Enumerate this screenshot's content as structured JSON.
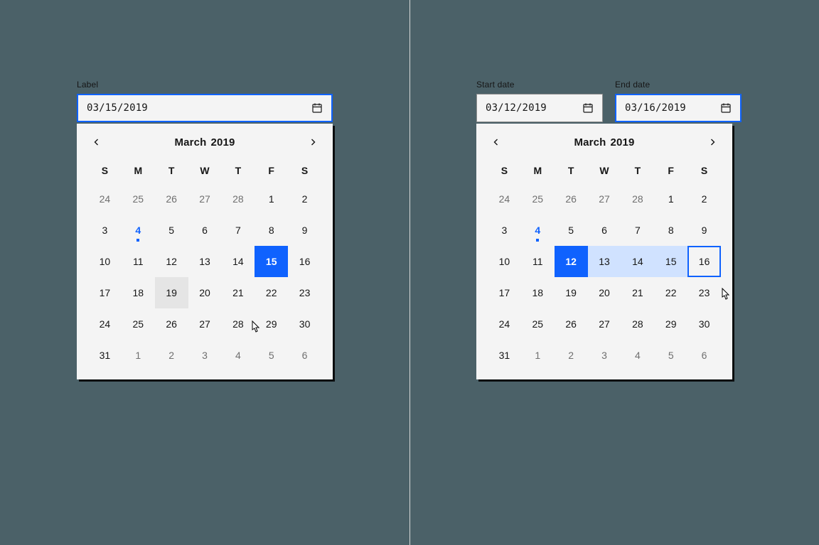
{
  "left": {
    "field_label": "Label",
    "input_value": "03/15/2019",
    "month": "March",
    "year": "2019",
    "dow": [
      "S",
      "M",
      "T",
      "W",
      "T",
      "F",
      "S"
    ],
    "weeks": [
      [
        {
          "n": "24",
          "out": true
        },
        {
          "n": "25",
          "out": true
        },
        {
          "n": "26",
          "out": true
        },
        {
          "n": "27",
          "out": true
        },
        {
          "n": "28",
          "out": true
        },
        {
          "n": "1"
        },
        {
          "n": "2"
        }
      ],
      [
        {
          "n": "3"
        },
        {
          "n": "4",
          "today": true
        },
        {
          "n": "5"
        },
        {
          "n": "6"
        },
        {
          "n": "7"
        },
        {
          "n": "8"
        },
        {
          "n": "9"
        }
      ],
      [
        {
          "n": "10"
        },
        {
          "n": "11"
        },
        {
          "n": "12"
        },
        {
          "n": "13"
        },
        {
          "n": "14"
        },
        {
          "n": "15",
          "selected": true
        },
        {
          "n": "16"
        }
      ],
      [
        {
          "n": "17"
        },
        {
          "n": "18"
        },
        {
          "n": "19",
          "hover": true
        },
        {
          "n": "20"
        },
        {
          "n": "21"
        },
        {
          "n": "22"
        },
        {
          "n": "23"
        }
      ],
      [
        {
          "n": "24"
        },
        {
          "n": "25"
        },
        {
          "n": "26"
        },
        {
          "n": "27"
        },
        {
          "n": "28"
        },
        {
          "n": "29"
        },
        {
          "n": "30"
        }
      ],
      [
        {
          "n": "31"
        },
        {
          "n": "1",
          "out": true
        },
        {
          "n": "2",
          "out": true
        },
        {
          "n": "3",
          "out": true
        },
        {
          "n": "4",
          "out": true
        },
        {
          "n": "5",
          "out": true
        },
        {
          "n": "6",
          "out": true
        }
      ]
    ]
  },
  "right": {
    "start_label": "Start date",
    "end_label": "End date",
    "start_value": "03/12/2019",
    "end_value": "03/16/2019",
    "month": "March",
    "year": "2019",
    "dow": [
      "S",
      "M",
      "T",
      "W",
      "T",
      "F",
      "S"
    ],
    "weeks": [
      [
        {
          "n": "24",
          "out": true
        },
        {
          "n": "25",
          "out": true
        },
        {
          "n": "26",
          "out": true
        },
        {
          "n": "27",
          "out": true
        },
        {
          "n": "28",
          "out": true
        },
        {
          "n": "1"
        },
        {
          "n": "2"
        }
      ],
      [
        {
          "n": "3"
        },
        {
          "n": "4",
          "today": true
        },
        {
          "n": "5"
        },
        {
          "n": "6"
        },
        {
          "n": "7"
        },
        {
          "n": "8"
        },
        {
          "n": "9"
        }
      ],
      [
        {
          "n": "10"
        },
        {
          "n": "11"
        },
        {
          "n": "12",
          "selected": true
        },
        {
          "n": "13",
          "range": true
        },
        {
          "n": "14",
          "range": true
        },
        {
          "n": "15",
          "range": true
        },
        {
          "n": "16",
          "range_end": true
        }
      ],
      [
        {
          "n": "17"
        },
        {
          "n": "18"
        },
        {
          "n": "19"
        },
        {
          "n": "20"
        },
        {
          "n": "21"
        },
        {
          "n": "22"
        },
        {
          "n": "23"
        }
      ],
      [
        {
          "n": "24"
        },
        {
          "n": "25"
        },
        {
          "n": "26"
        },
        {
          "n": "27"
        },
        {
          "n": "28"
        },
        {
          "n": "29"
        },
        {
          "n": "30"
        }
      ],
      [
        {
          "n": "31"
        },
        {
          "n": "1",
          "out": true
        },
        {
          "n": "2",
          "out": true
        },
        {
          "n": "3",
          "out": true
        },
        {
          "n": "4",
          "out": true
        },
        {
          "n": "5",
          "out": true
        },
        {
          "n": "6",
          "out": true
        }
      ]
    ]
  }
}
